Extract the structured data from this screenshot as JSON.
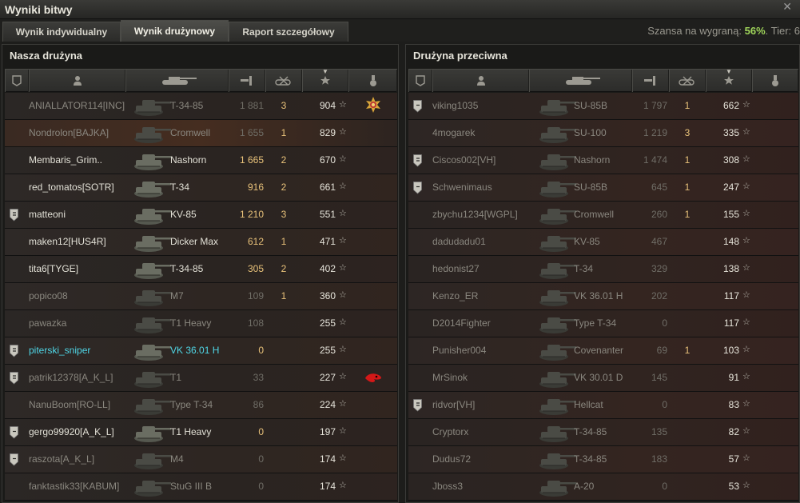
{
  "window": {
    "title": "Wyniki bitwy"
  },
  "tabs": [
    {
      "label": "Wynik indywidualny"
    },
    {
      "label": "Wynik drużynowy"
    },
    {
      "label": "Raport szczegółowy"
    }
  ],
  "chance": {
    "label": "Szansa na wygraną:",
    "value": "56%",
    "tier": ". Tier: 6"
  },
  "ours": {
    "title": "Nasza drużyna",
    "rows": [
      {
        "name": "ANIALLATOR114[INC]",
        "tank": "T-34-85",
        "dmg": "1 881",
        "kills": "3",
        "xp": "904",
        "status": "dead",
        "medal": "orden"
      },
      {
        "name": "Nondrolon[BAJKA]",
        "tank": "Cromwell",
        "dmg": "1 655",
        "kills": "1",
        "xp": "829",
        "status": "dead",
        "hl": true
      },
      {
        "name": "Membaris_Grim..",
        "tank": "Nashorn",
        "dmg": "1 665",
        "kills": "2",
        "xp": "670",
        "status": "alive"
      },
      {
        "name": "red_tomatos[SOTR]",
        "tank": "T-34",
        "dmg": "916",
        "kills": "2",
        "xp": "661",
        "status": "alive"
      },
      {
        "name": "matteoni",
        "tank": "KV-85",
        "dmg": "1 210",
        "kills": "3",
        "xp": "551",
        "status": "alive",
        "badge": "2"
      },
      {
        "name": "maken12[HUS4R]",
        "tank": "Dicker Max",
        "dmg": "612",
        "kills": "1",
        "xp": "471",
        "status": "alive"
      },
      {
        "name": "tita6[TYGE]",
        "tank": "T-34-85",
        "dmg": "305",
        "kills": "2",
        "xp": "402",
        "status": "alive"
      },
      {
        "name": "popico08",
        "tank": "M7",
        "dmg": "109",
        "kills": "1",
        "xp": "360",
        "status": "dead"
      },
      {
        "name": "pawazka",
        "tank": "T1 Heavy",
        "dmg": "108",
        "kills": "",
        "xp": "255",
        "status": "dead"
      },
      {
        "name": "piterski_sniper",
        "tank": "VK 36.01 H",
        "dmg": "0",
        "kills": "",
        "xp": "255",
        "status": "self",
        "badge": "2"
      },
      {
        "name": "patrik12378[A_K_L]",
        "tank": "T1",
        "dmg": "33",
        "kills": "",
        "xp": "227",
        "status": "dead",
        "badge": "2",
        "medal": "red"
      },
      {
        "name": "NanuBoom[RO-LL]",
        "tank": "Type T-34",
        "dmg": "86",
        "kills": "",
        "xp": "224",
        "status": "dead"
      },
      {
        "name": "gergo99920[A_K_L]",
        "tank": "T1 Heavy",
        "dmg": "0",
        "kills": "",
        "xp": "197",
        "status": "alive",
        "badge": "1",
        "dmgAlive": true
      },
      {
        "name": "raszota[A_K_L]",
        "tank": "M4",
        "dmg": "0",
        "kills": "",
        "xp": "174",
        "status": "dead",
        "badge": "1"
      },
      {
        "name": "fanktastik33[KABUM]",
        "tank": "StuG III B",
        "dmg": "0",
        "kills": "",
        "xp": "174",
        "status": "dead"
      }
    ]
  },
  "enemy": {
    "title": "Drużyna przeciwna",
    "rows": [
      {
        "name": "viking1035",
        "tank": "SU-85B",
        "dmg": "1 797",
        "kills": "1",
        "xp": "662",
        "status": "dead",
        "badge": "1"
      },
      {
        "name": "4mogarek",
        "tank": "SU-100",
        "dmg": "1 219",
        "kills": "3",
        "xp": "335",
        "status": "dead"
      },
      {
        "name": "Ciscos002[VH]",
        "tank": "Nashorn",
        "dmg": "1 474",
        "kills": "1",
        "xp": "308",
        "status": "dead",
        "badge": "2"
      },
      {
        "name": "Schwenimaus",
        "tank": "SU-85B",
        "dmg": "645",
        "kills": "1",
        "xp": "247",
        "status": "dead",
        "badge": "1"
      },
      {
        "name": "zbychu1234[WGPL]",
        "tank": "Cromwell",
        "dmg": "260",
        "kills": "1",
        "xp": "155",
        "status": "dead"
      },
      {
        "name": "dadudadu01",
        "tank": "KV-85",
        "dmg": "467",
        "kills": "",
        "xp": "148",
        "status": "dead"
      },
      {
        "name": "hedonist27",
        "tank": "T-34",
        "dmg": "329",
        "kills": "",
        "xp": "138",
        "status": "dead"
      },
      {
        "name": "Kenzo_ER",
        "tank": "VK 36.01 H",
        "dmg": "202",
        "kills": "",
        "xp": "117",
        "status": "dead"
      },
      {
        "name": "D2014Fighter",
        "tank": "Type T-34",
        "dmg": "0",
        "kills": "",
        "xp": "117",
        "status": "dead"
      },
      {
        "name": "Punisher004",
        "tank": "Covenanter",
        "dmg": "69",
        "kills": "1",
        "xp": "103",
        "status": "dead"
      },
      {
        "name": "MrSinok",
        "tank": "VK 30.01 D",
        "dmg": "145",
        "kills": "",
        "xp": "91",
        "status": "dead"
      },
      {
        "name": "ridvor[VH]",
        "tank": "Hellcat",
        "dmg": "0",
        "kills": "",
        "xp": "83",
        "status": "dead",
        "badge": "2"
      },
      {
        "name": "Cryptorx",
        "tank": "T-34-85",
        "dmg": "135",
        "kills": "",
        "xp": "82",
        "status": "dead"
      },
      {
        "name": "Dudus72",
        "tank": "T-34-85",
        "dmg": "183",
        "kills": "",
        "xp": "57",
        "status": "dead"
      },
      {
        "name": "Jboss3",
        "tank": "A-20",
        "dmg": "0",
        "kills": "",
        "xp": "53",
        "status": "dead"
      }
    ]
  },
  "icons": {
    "badge": "class-badge-icon",
    "player": "player-icon",
    "tank": "tank-icon",
    "damage": "damage-icon",
    "kills": "kills-icon",
    "xp": "star-icon",
    "medal": "medal-icon"
  },
  "colors": {
    "accent": "#9fd45a",
    "self": "#4fd6e6",
    "damage": "#e8c27a"
  },
  "star_glyph": "☆"
}
